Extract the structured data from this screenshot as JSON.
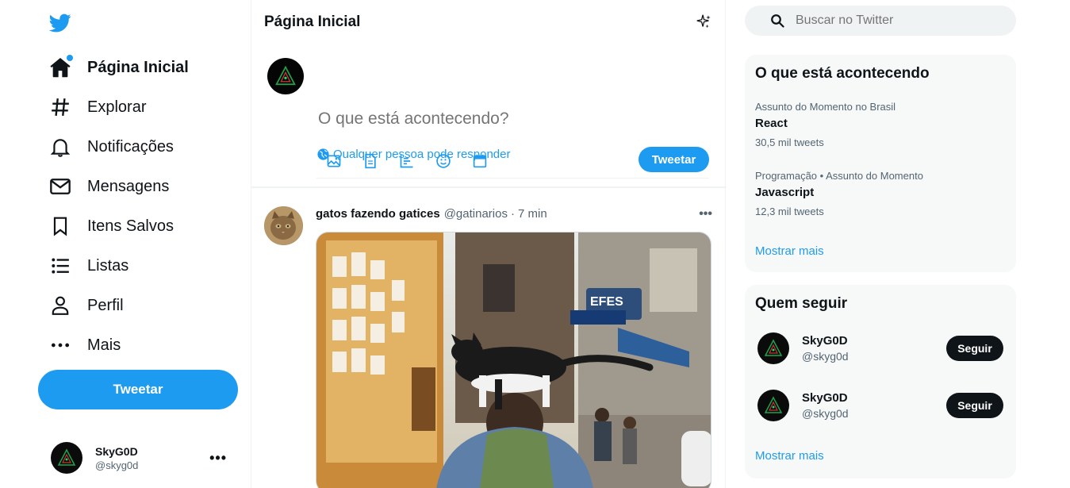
{
  "sidebar": {
    "logo": "twitter-bird-icon",
    "items": [
      {
        "label": "Página Inicial",
        "icon": "home-icon",
        "active": true
      },
      {
        "label": "Explorar",
        "icon": "hashtag-icon"
      },
      {
        "label": "Notificações",
        "icon": "bell-icon"
      },
      {
        "label": "Mensagens",
        "icon": "envelope-icon"
      },
      {
        "label": "Itens Salvos",
        "icon": "bookmark-icon"
      },
      {
        "label": "Listas",
        "icon": "list-icon"
      },
      {
        "label": "Perfil",
        "icon": "user-icon"
      },
      {
        "label": "Mais",
        "icon": "more-icon"
      }
    ],
    "tweet_label": "Tweetar",
    "account": {
      "name": "SkyG0D",
      "handle": "@skyg0d"
    }
  },
  "main": {
    "title": "Página Inicial",
    "composer": {
      "placeholder": "O que está acontecendo?",
      "reply_scope": "Qualquer pessoa pode responder",
      "tools": [
        "image-icon",
        "gif-icon",
        "poll-icon",
        "emoji-icon",
        "schedule-icon"
      ],
      "tweet_label": "Tweetar"
    },
    "post": {
      "name": "gatos fazendo gatices",
      "handle": "@gatinarios",
      "separator": "·",
      "time": "7 min"
    }
  },
  "right": {
    "search_placeholder": "Buscar no Twitter",
    "trends": {
      "title": "O que está acontecendo",
      "items": [
        {
          "context": "Assunto do Momento no Brasil",
          "topic": "React",
          "count": "30,5 mil tweets"
        },
        {
          "context": "Programação • Assunto do Momento",
          "topic": "Javascript",
          "count": "12,3 mil tweets"
        }
      ],
      "show_more": "Mostrar mais"
    },
    "who_to_follow": {
      "title": "Quem seguir",
      "items": [
        {
          "name": "SkyG0D",
          "handle": "@skyg0d",
          "button": "Seguir"
        },
        {
          "name": "SkyG0D",
          "handle": "@skyg0d",
          "button": "Seguir"
        }
      ],
      "show_more": "Mostrar mais"
    }
  },
  "colors": {
    "accent": "#1d9bf0",
    "text": "#0f1419",
    "muted": "#536471",
    "panel": "#f7f9f9"
  }
}
